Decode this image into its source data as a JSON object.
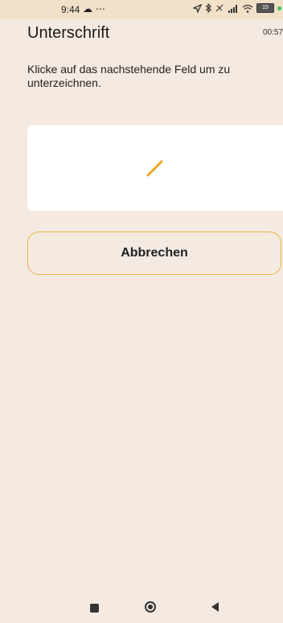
{
  "status_bar": {
    "time": "9:44",
    "left_icons": "☁ ⋯",
    "battery": "15"
  },
  "header": {
    "title": "Unterschrift",
    "timer": "00:57"
  },
  "main": {
    "instruction": "Klicke auf das nachstehende Feld um zu unterzeichnen.",
    "signature_icon": "pencil-icon",
    "cancel_label": "Abbrechen"
  },
  "colors": {
    "background": "#f4eae2",
    "accent": "#e7b640",
    "status_bar": "#f1e1c9"
  }
}
